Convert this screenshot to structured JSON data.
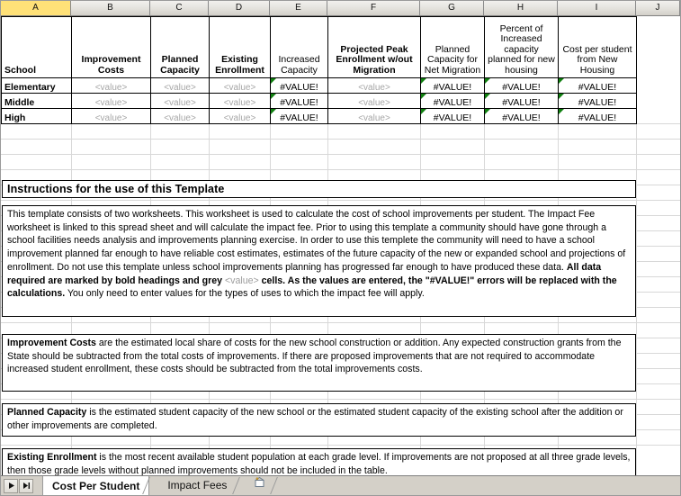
{
  "app": {
    "type": "spreadsheet"
  },
  "columns": {
    "letters": [
      "A",
      "B",
      "C",
      "D",
      "E",
      "F",
      "G",
      "H",
      "I",
      "J"
    ],
    "active": "A"
  },
  "table": {
    "headers": [
      {
        "label": "School",
        "bold": true
      },
      {
        "label": "Improvement Costs",
        "bold": true
      },
      {
        "label": "Planned Capacity",
        "bold": true
      },
      {
        "label": "Existing Enrollment",
        "bold": true
      },
      {
        "label": "Increased Capacity",
        "bold": false
      },
      {
        "label": "Projected Peak Enrollment w/out Migration",
        "bold": true
      },
      {
        "label": "Planned Capacity for Net Migration",
        "bold": false
      },
      {
        "label": "Percent of Increased capacity planned for new housing",
        "bold": false
      },
      {
        "label": "Cost per student from New Housing",
        "bold": false
      }
    ],
    "placeholder": "<value>",
    "error": "#VALUE!",
    "rows": [
      {
        "school": "Elementary",
        "cells": [
          {
            "text": "<value>",
            "kind": "placeholder",
            "flag": false
          },
          {
            "text": "<value>",
            "kind": "placeholder",
            "flag": false
          },
          {
            "text": "<value>",
            "kind": "placeholder",
            "flag": false
          },
          {
            "text": "#VALUE!",
            "kind": "error",
            "flag": true
          },
          {
            "text": "<value>",
            "kind": "placeholder",
            "flag": false
          },
          {
            "text": "#VALUE!",
            "kind": "error",
            "flag": true
          },
          {
            "text": "#VALUE!",
            "kind": "error",
            "flag": true
          },
          {
            "text": "#VALUE!",
            "kind": "error",
            "flag": true
          }
        ]
      },
      {
        "school": "Middle",
        "cells": [
          {
            "text": "<value>",
            "kind": "placeholder",
            "flag": false
          },
          {
            "text": "<value>",
            "kind": "placeholder",
            "flag": false
          },
          {
            "text": "<value>",
            "kind": "placeholder",
            "flag": false
          },
          {
            "text": "#VALUE!",
            "kind": "error",
            "flag": true
          },
          {
            "text": "<value>",
            "kind": "placeholder",
            "flag": false
          },
          {
            "text": "#VALUE!",
            "kind": "error",
            "flag": true
          },
          {
            "text": "#VALUE!",
            "kind": "error",
            "flag": true
          },
          {
            "text": "#VALUE!",
            "kind": "error",
            "flag": true
          }
        ]
      },
      {
        "school": "High",
        "cells": [
          {
            "text": "<value>",
            "kind": "placeholder",
            "flag": false
          },
          {
            "text": "<value>",
            "kind": "placeholder",
            "flag": false
          },
          {
            "text": "<value>",
            "kind": "placeholder",
            "flag": false
          },
          {
            "text": "#VALUE!",
            "kind": "error",
            "flag": true
          },
          {
            "text": "<value>",
            "kind": "placeholder",
            "flag": false
          },
          {
            "text": "#VALUE!",
            "kind": "error",
            "flag": true
          },
          {
            "text": "#VALUE!",
            "kind": "error",
            "flag": true
          },
          {
            "text": "#VALUE!",
            "kind": "error",
            "flag": true
          }
        ]
      }
    ]
  },
  "instructions": {
    "heading": "Instructions for the use of this Template",
    "paragraphs": [
      {
        "id": "overview",
        "runs": [
          {
            "t": "This template consists of two worksheets.  This worksheet is used to calculate the cost of school improvements per student.  The Impact Fee worksheet is linked to this spread sheet and will calculate the impact fee.  Prior to using this template a community should have gone through a school facilities needs analysis and improvements planning exercise.  In order to use this templete the community will need to have a school improvement planned far enough to have reliable cost estimates, estimates of the future capacity of the new or expanded school and projections of enrollment.  Do not use this template unless school improvements planning has progressed far enough to have produced these data. ",
            "s": "normal"
          },
          {
            "t": "All data required are marked by bold headings and grey ",
            "s": "bold"
          },
          {
            "t": "<value>",
            "s": "grey"
          },
          {
            "t": " cells.  As the values are entered, the \"#VALUE!\" errors will be replaced with the calculations.",
            "s": "bold"
          },
          {
            "t": "  You only need to enter values for the types of uses to which the impact fee will apply.",
            "s": "normal"
          }
        ]
      },
      {
        "id": "improvement-costs",
        "runs": [
          {
            "t": "Improvement Costs",
            "s": "bold"
          },
          {
            "t": " are the estimated local share of costs for the new school construction or addition.  Any expected construction grants from the State should be subtracted from the total costs of improvements.  If there are proposed improvements that are not required to accommodate increased student enrollment, these costs should be subtracted from the total improvements costs.",
            "s": "normal"
          }
        ]
      },
      {
        "id": "planned-capacity",
        "runs": [
          {
            "t": "Planned Capacity",
            "s": "bold"
          },
          {
            "t": " is the estimated student capacity of the new school or the estimated student capacity of the existing school after the addition or other improvements are completed.",
            "s": "normal"
          }
        ]
      },
      {
        "id": "existing-enrollment",
        "runs": [
          {
            "t": "Existing Enrollment",
            "s": "bold"
          },
          {
            "t": " is the most recent available student population at each grade level.  If improvements are not proposed at all three grade levels, then those grade levels without planned improvements should not be included in the table.",
            "s": "normal"
          }
        ]
      }
    ]
  },
  "tabs": {
    "items": [
      {
        "label": "Cost Per Student",
        "active": true
      },
      {
        "label": "Impact Fees",
        "active": false
      }
    ],
    "insert_sheet_icon": "insert-worksheet-icon",
    "nav_prev_icon": "nav-prev-icon",
    "nav_next_icon": "nav-next-icon"
  },
  "colors": {
    "active_column_header": "#ffe178",
    "header_bar": "#d4d0c8",
    "placeholder_text": "#a6a6a6",
    "error_flag": "#108010",
    "gridline": "#d8d8d8"
  }
}
